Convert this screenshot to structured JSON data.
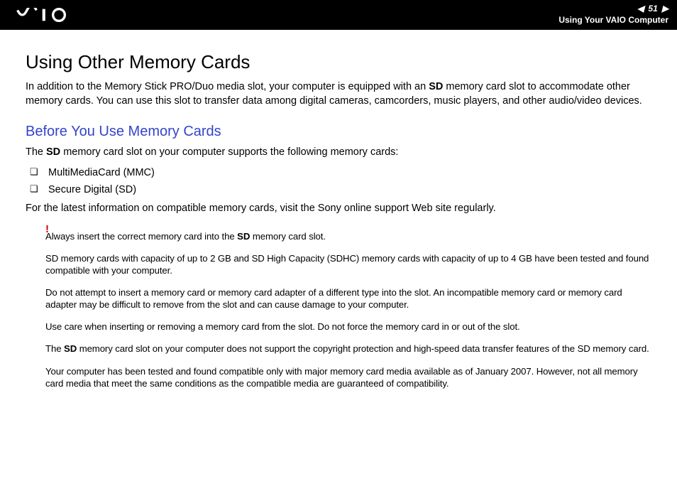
{
  "header": {
    "page_number": "51",
    "breadcrumb": "Using Your VAIO Computer"
  },
  "h1": "Using Other Memory Cards",
  "intro_pre": "In addition to the Memory Stick PRO/Duo media slot, your computer is equipped with an ",
  "intro_bold": "SD",
  "intro_post": " memory card slot to accommodate other memory cards. You can use this slot to transfer data among digital cameras, camcorders, music players, and other audio/video devices.",
  "h2": "Before You Use Memory Cards",
  "support_pre": "The ",
  "support_bold": "SD",
  "support_post": " memory card slot on your computer supports the following memory cards:",
  "bullets": {
    "b0": "MultiMediaCard (MMC)",
    "b1": "Secure Digital (SD)"
  },
  "latest": "For the latest information on compatible memory cards, visit the Sony online support Web site regularly.",
  "warn": "!",
  "note1_pre": "Always insert the correct memory card into the ",
  "note1_bold": "SD",
  "note1_post": " memory card slot.",
  "note2": "SD memory cards with capacity of up to 2 GB and SD High Capacity (SDHC) memory cards with capacity of up to 4 GB have been tested and found compatible with your computer.",
  "note3": "Do not attempt to insert a memory card or memory card adapter of a different type into the slot. An incompatible memory card or memory card adapter may be difficult to remove from the slot and can cause damage to your computer.",
  "note4": "Use care when inserting or removing a memory card from the slot. Do not force the memory card in or out of the slot.",
  "note5_pre": "The ",
  "note5_bold": "SD",
  "note5_post": " memory card slot on your computer does not support the copyright protection and high-speed data transfer features of the SD memory card.",
  "note6": "Your computer has been tested and found compatible only with major memory card media available as of January 2007. However, not all memory card media that meet the same conditions as the compatible media are guaranteed of compatibility."
}
